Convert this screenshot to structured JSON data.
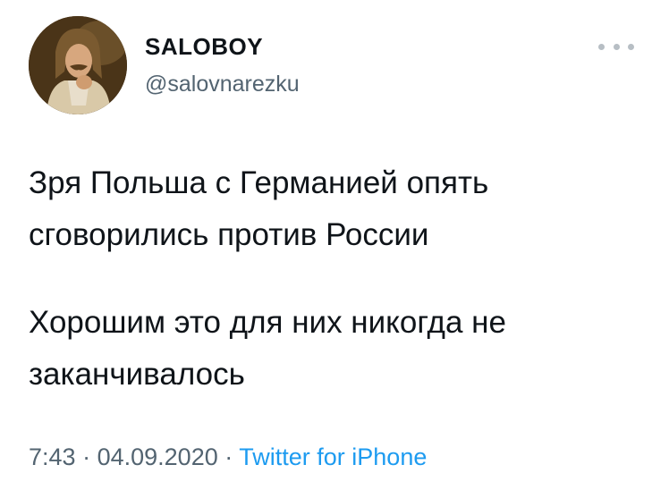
{
  "user": {
    "display_name": "SALOBOY",
    "handle": "@salovnarezku",
    "avatar_icon": "profile-photo"
  },
  "tweet": {
    "paragraphs": [
      "Зря Польша с Германией опять сговорились против России",
      "Хорошим это для них никогда не заканчивалось"
    ]
  },
  "meta": {
    "time": "7:43",
    "separator": "·",
    "date": "04.09.2020",
    "source": "Twitter for iPhone"
  },
  "menu": {
    "icon": "more-options-icon"
  },
  "colors": {
    "text": "#0f1419",
    "secondary": "#536471",
    "accent": "#1d9bf0"
  }
}
